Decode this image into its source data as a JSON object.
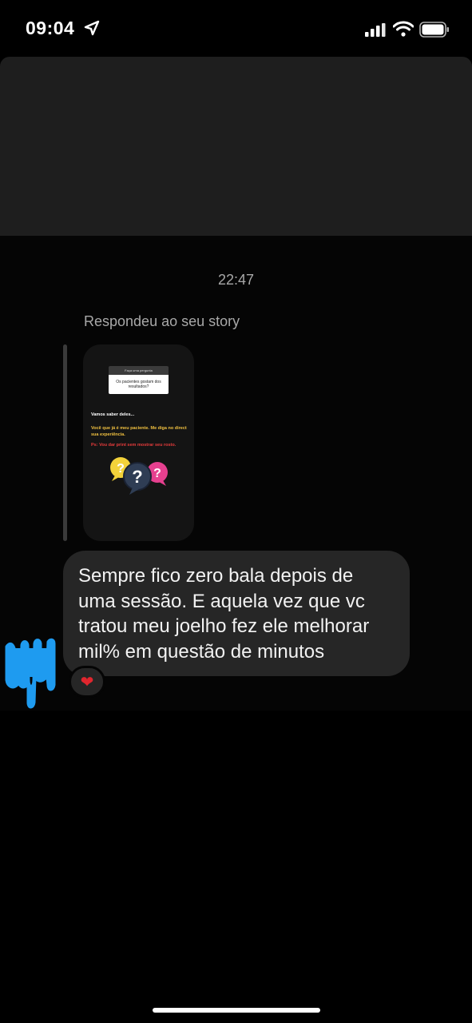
{
  "status_bar": {
    "time": "09:04"
  },
  "chat": {
    "timestamp": "22:47",
    "replied_label": "Respondeu ao seu story",
    "story": {
      "question_header": "Faça uma pergunta",
      "question": "Os pacientes gostam dos resultados?",
      "line1": "Vamos saber deles...",
      "line2": "Você que já é meu paciente.  Me diga no direct sua experiência.",
      "line3": "Ps: Vou dar print sem mostrar seu rosto."
    },
    "message": "Sempre fico zero bala depois de uma sessão. E aquela vez que vc tratou meu joelho fez ele melhorar mil% em questão de minutos",
    "reaction": "❤"
  },
  "colors": {
    "background": "#000000",
    "panel": "#1e1e1e",
    "bubble": "#262626",
    "secondary_text": "#a8a8a8",
    "avatar_scribble": "#1e9bf0",
    "heart": "#e0262e"
  },
  "icons": [
    "location-arrow-icon",
    "cellular-signal-icon",
    "wifi-icon",
    "battery-icon",
    "heart-reaction-icon"
  ]
}
